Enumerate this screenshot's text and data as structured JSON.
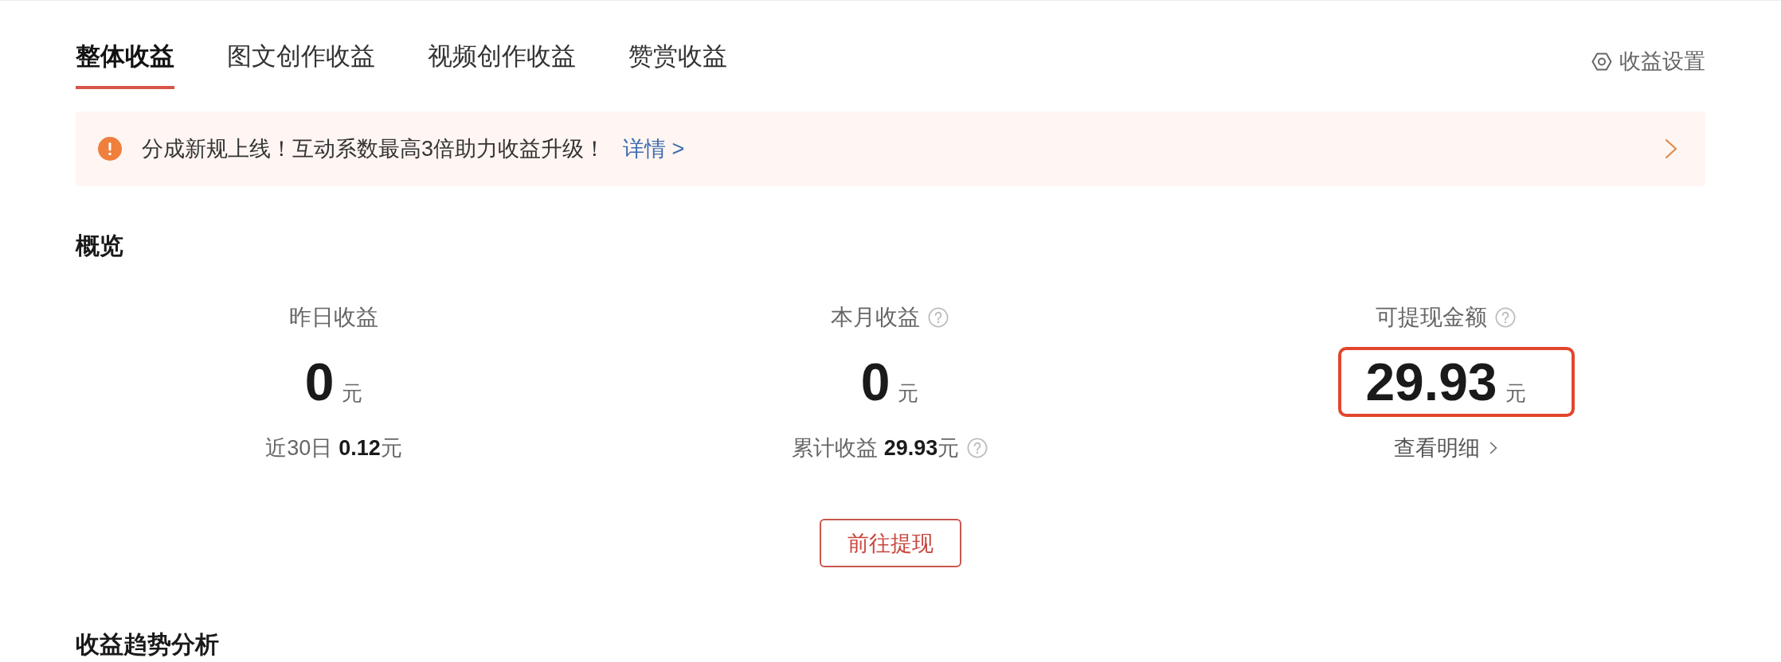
{
  "tabs": [
    {
      "label": "整体收益",
      "selected": true
    },
    {
      "label": "图文创作收益",
      "selected": false
    },
    {
      "label": "视频创作收益",
      "selected": false
    },
    {
      "label": "赞赏收益",
      "selected": false
    }
  ],
  "settings_link": {
    "label": "收益设置"
  },
  "notice": {
    "text": "分成新规上线！互动系数最高3倍助力收益升级！",
    "link": "详情 >"
  },
  "overview": {
    "title": "概览",
    "stats": [
      {
        "label": "昨日收益",
        "help": false,
        "value": "0",
        "unit": "元",
        "highlighted": false,
        "footer": {
          "kind": "text",
          "label": "近30日",
          "amount": "0.12",
          "unit": "元",
          "help": false
        }
      },
      {
        "label": "本月收益",
        "help": true,
        "value": "0",
        "unit": "元",
        "highlighted": false,
        "footer": {
          "kind": "text",
          "label": "累计收益",
          "amount": "29.93",
          "unit": "元",
          "help": true
        }
      },
      {
        "label": "可提现金额",
        "help": true,
        "value": "29.93",
        "unit": "元",
        "highlighted": true,
        "footer": {
          "kind": "link",
          "label": "查看明细",
          "help": false
        }
      }
    ]
  },
  "withdraw_button": "前往提现",
  "trend": {
    "title": "收益趋势分析"
  }
}
